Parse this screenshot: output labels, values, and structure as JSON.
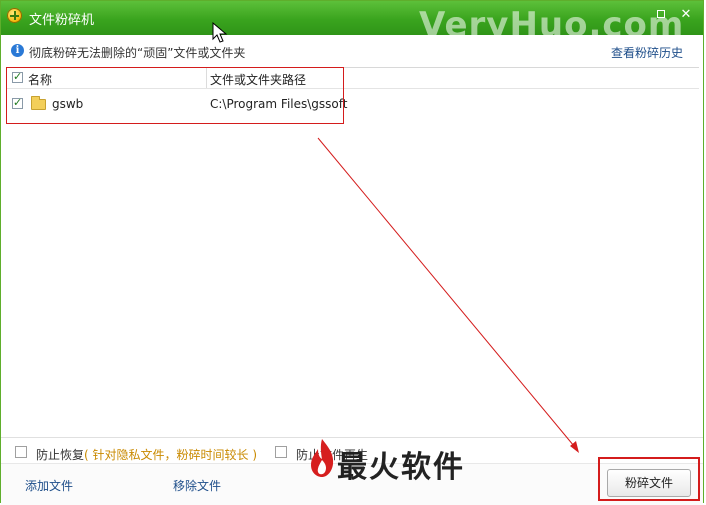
{
  "window": {
    "title": "文件粉碎机",
    "watermark": "VeryHuo.com"
  },
  "infobar": {
    "message": "彻底粉碎无法删除的“顽固”文件或文件夹",
    "history_link": "查看粉碎历史"
  },
  "list": {
    "columns": [
      "名称",
      "文件或文件夹路径"
    ],
    "rows": [
      {
        "name": "gswb",
        "path": "C:\\Program Files\\gssoft",
        "checked": true
      }
    ]
  },
  "options": {
    "prevent_recovery": {
      "label": "防止恢复",
      "note": "( 针对隐私文件，粉碎时间较长 )",
      "checked": false
    },
    "prevent_regen": {
      "label": "防止文件再生",
      "checked": false
    }
  },
  "footer": {
    "add_file": "添加文件",
    "remove_file": "移除文件",
    "brand_text": "最火软件",
    "shred_button": "粉碎文件"
  },
  "colors": {
    "title_green": "#3aa41e",
    "highlight_red": "#d41c1c",
    "link_blue": "#1e4e8a",
    "note_orange": "#c98a00"
  },
  "icons": [
    "app-icon",
    "maximize-icon",
    "close-icon",
    "info-icon",
    "checkbox-icon",
    "folder-icon",
    "brand-flame-icon",
    "mouse-cursor-icon"
  ]
}
